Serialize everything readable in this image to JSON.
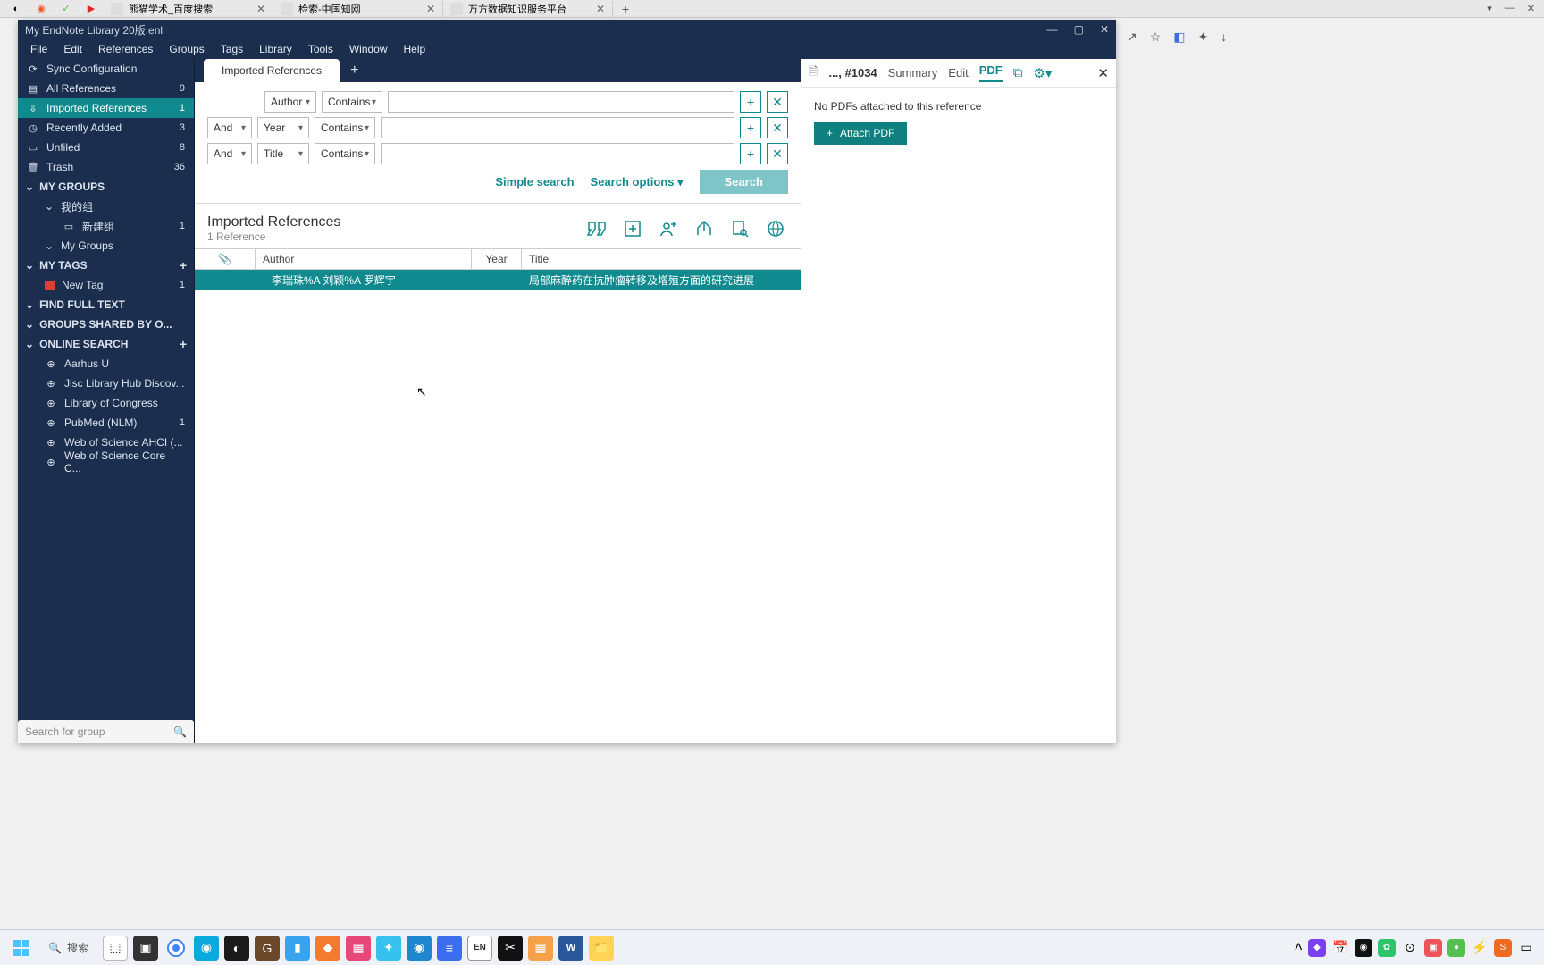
{
  "browser": {
    "tabs": [
      {
        "title": "熊猫学术_百度搜索"
      },
      {
        "title": "检索-中国知网"
      },
      {
        "title": "万方数据知识服务平台"
      }
    ]
  },
  "window": {
    "title": "My EndNote Library 20版.enl"
  },
  "menubar": [
    "File",
    "Edit",
    "References",
    "Groups",
    "Tags",
    "Library",
    "Tools",
    "Window",
    "Help"
  ],
  "sidebar": {
    "sync": "Sync Configuration",
    "all_refs": {
      "label": "All References",
      "count": "9"
    },
    "imported": {
      "label": "Imported References",
      "count": "1"
    },
    "recently": {
      "label": "Recently Added",
      "count": "3"
    },
    "unfiled": {
      "label": "Unfiled",
      "count": "8"
    },
    "trash": {
      "label": "Trash",
      "count": "36"
    },
    "my_groups_header": "MY GROUPS",
    "my_group_cn": "我的组",
    "new_group_cn": {
      "label": "新建组",
      "count": "1"
    },
    "my_groups_item": "My Groups",
    "my_tags_header": "MY TAGS",
    "new_tag": {
      "label": "New Tag",
      "count": "1"
    },
    "find_full_text": "FIND FULL TEXT",
    "groups_shared": "GROUPS SHARED BY O...",
    "online_search_header": "ONLINE SEARCH",
    "online": [
      {
        "label": "Aarhus U"
      },
      {
        "label": "Jisc Library Hub Discov..."
      },
      {
        "label": "Library of Congress"
      },
      {
        "label": "PubMed (NLM)",
        "count": "1"
      },
      {
        "label": "Web of Science AHCI (..."
      },
      {
        "label": "Web of Science Core C..."
      }
    ],
    "search_placeholder": "Search for group"
  },
  "tabs": {
    "active": "Imported References"
  },
  "search": {
    "rows": [
      {
        "logic": "",
        "field": "Author",
        "op": "Contains"
      },
      {
        "logic": "And",
        "field": "Year",
        "op": "Contains"
      },
      {
        "logic": "And",
        "field": "Title",
        "op": "Contains"
      }
    ],
    "simple": "Simple search",
    "options": "Search options",
    "search_btn": "Search"
  },
  "results": {
    "title": "Imported References",
    "subtitle": "1 Reference",
    "headers": {
      "author": "Author",
      "year": "Year",
      "title": "Title"
    },
    "row": {
      "author": "李瑞珠%A 刘颖%A 罗辉宇",
      "year": "",
      "title": "局部麻醉药在抗肿瘤转移及增殖方面的研究进展"
    }
  },
  "right_panel": {
    "ref_id": "..., #1034",
    "summary": "Summary",
    "edit": "Edit",
    "pdf": "PDF",
    "no_pdf": "No PDFs attached to this reference",
    "attach": "Attach PDF"
  },
  "taskbar": {
    "search": "搜索"
  }
}
